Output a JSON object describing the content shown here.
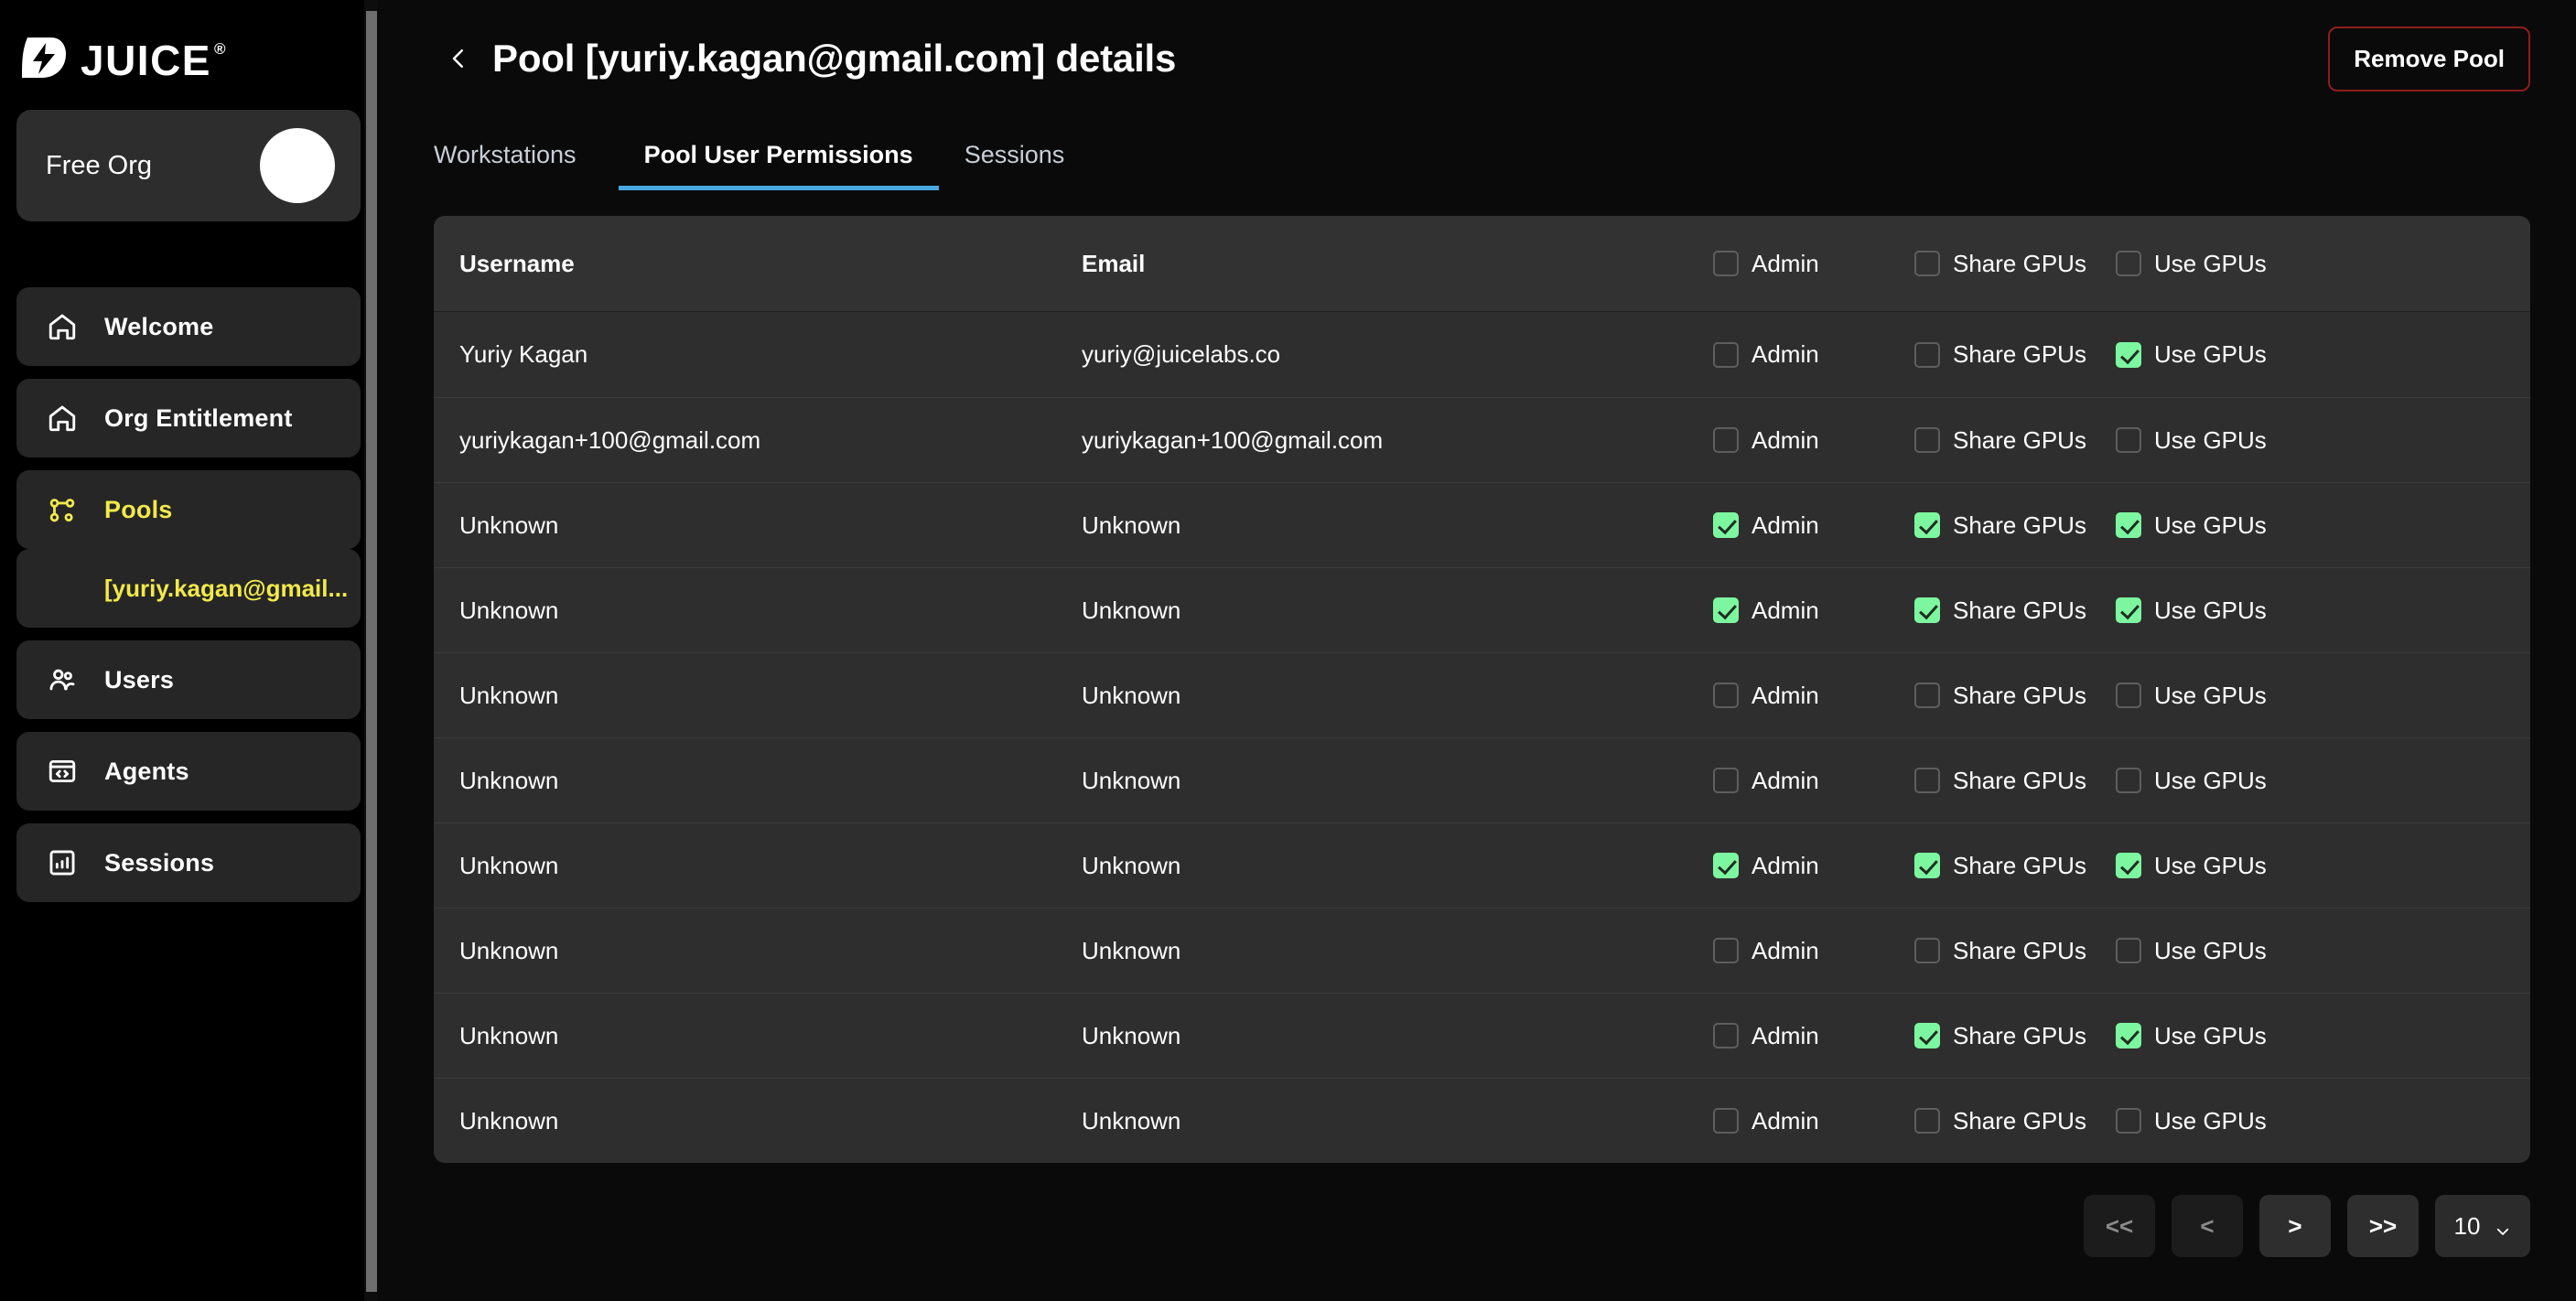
{
  "brand": {
    "word": "JUICE",
    "registered": "®",
    "logo_icon": "juice-lightning-logo"
  },
  "org": {
    "name": "Free Org",
    "avatar_icon": "user-avatar"
  },
  "sidebar": {
    "items": [
      {
        "label": "Welcome",
        "icon": "home-icon",
        "active": false
      },
      {
        "label": "Org Entitlement",
        "icon": "home-icon",
        "active": false
      },
      {
        "label": "Pools",
        "icon": "network-nodes-icon",
        "active": true
      },
      {
        "label": "Users",
        "icon": "users-icon",
        "active": false
      },
      {
        "label": "Agents",
        "icon": "code-window-icon",
        "active": false
      },
      {
        "label": "Sessions",
        "icon": "bar-chart-box-icon",
        "active": false
      }
    ],
    "sub_item": {
      "label": "[yuriy.kagan@gmail..."
    }
  },
  "header": {
    "back_icon": "chevron-left-icon",
    "title": "Pool [yuriy.kagan@gmail.com] details",
    "remove_label": "Remove Pool",
    "remove_border_color": "#8e1d1d"
  },
  "tabs": [
    {
      "label": "Workstations",
      "active": false
    },
    {
      "label": "Pool User Permissions",
      "active": true
    },
    {
      "label": "Sessions",
      "active": false
    }
  ],
  "tab_accent_color": "#4aa8e0",
  "checked_color": "#7df79f",
  "table": {
    "columns": {
      "username": "Username",
      "email": "Email"
    },
    "perm_labels": {
      "admin": "Admin",
      "share": "Share GPUs",
      "use": "Use GPUs"
    },
    "header_perms": {
      "admin": false,
      "share": false,
      "use": false
    },
    "rows": [
      {
        "username": "Yuriy Kagan",
        "email": "yuriy@juicelabs.co",
        "admin": false,
        "share": false,
        "use": true
      },
      {
        "username": "yuriykagan+100@gmail.com",
        "email": "yuriykagan+100@gmail.com",
        "admin": false,
        "share": false,
        "use": false
      },
      {
        "username": "Unknown",
        "email": "Unknown",
        "admin": true,
        "share": true,
        "use": true
      },
      {
        "username": "Unknown",
        "email": "Unknown",
        "admin": true,
        "share": true,
        "use": true
      },
      {
        "username": "Unknown",
        "email": "Unknown",
        "admin": false,
        "share": false,
        "use": false
      },
      {
        "username": "Unknown",
        "email": "Unknown",
        "admin": false,
        "share": false,
        "use": false
      },
      {
        "username": "Unknown",
        "email": "Unknown",
        "admin": true,
        "share": true,
        "use": true
      },
      {
        "username": "Unknown",
        "email": "Unknown",
        "admin": false,
        "share": false,
        "use": false
      },
      {
        "username": "Unknown",
        "email": "Unknown",
        "admin": false,
        "share": true,
        "use": true
      },
      {
        "username": "Unknown",
        "email": "Unknown",
        "admin": false,
        "share": false,
        "use": false
      }
    ]
  },
  "pagination": {
    "first_label": "<<",
    "prev_label": "<",
    "next_label": ">",
    "last_label": ">>",
    "page_size": "10",
    "chevron_icon": "chevron-down-icon"
  }
}
